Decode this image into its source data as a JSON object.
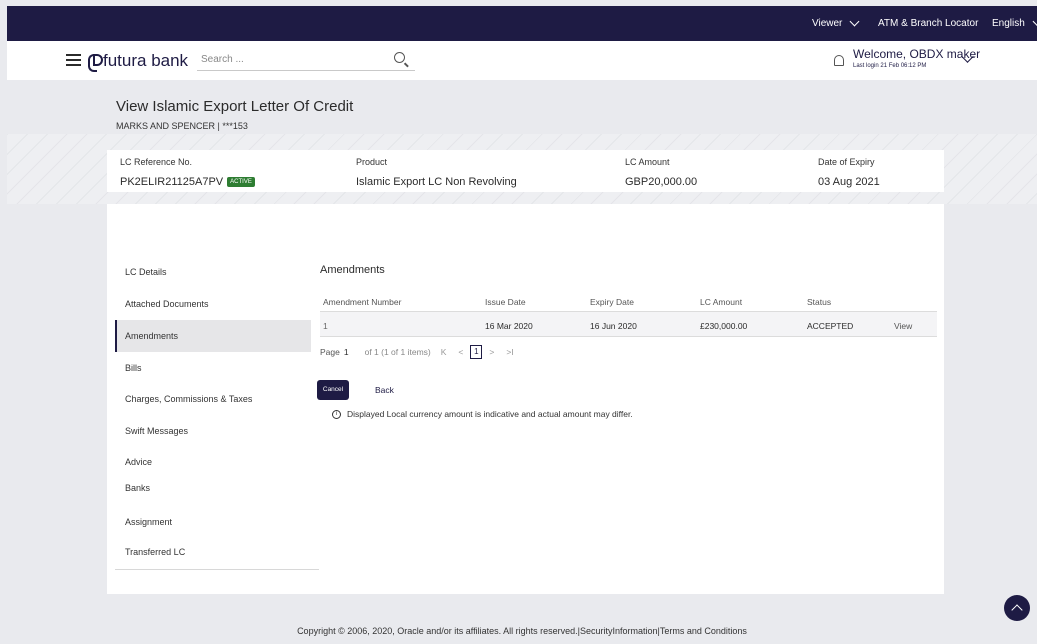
{
  "topbar": {
    "viewer_label": "Viewer",
    "atm_label": "ATM & Branch Locator",
    "language_label": "English"
  },
  "header": {
    "brand": "futura bank",
    "search_placeholder": "Search ...",
    "welcome": "Welcome, OBDX maker",
    "last_login": "Last login 21 Feb 06:12 PM"
  },
  "page": {
    "title": "View Islamic Export Letter Of Credit",
    "subtitle": "MARKS AND SPENCER | ***153"
  },
  "summary": {
    "lc_ref_label": "LC Reference No.",
    "lc_ref_value": "PK2ELIR21125A7PV",
    "status_badge": "ACTIVE",
    "product_label": "Product",
    "product_value": "Islamic Export LC Non Revolving",
    "amount_label": "LC Amount",
    "amount_value": "GBP20,000.00",
    "expiry_label": "Date of Expiry",
    "expiry_value": "03 Aug 2021"
  },
  "sidebar": {
    "items": [
      {
        "label": "LC Details"
      },
      {
        "label": "Attached Documents"
      },
      {
        "label": "Amendments"
      },
      {
        "label": "Bills"
      },
      {
        "label": "Charges, Commissions & Taxes"
      },
      {
        "label": "Swift Messages"
      },
      {
        "label": "Advice"
      },
      {
        "label": "Banks"
      },
      {
        "label": "Assignment"
      },
      {
        "label": "Transferred LC"
      }
    ]
  },
  "amendments": {
    "title": "Amendments",
    "columns": [
      "Amendment Number",
      "Issue Date",
      "Expiry Date",
      "LC Amount",
      "Status"
    ],
    "row": {
      "number": "1",
      "issue_date": "16 Mar 2020",
      "expiry_date": "16 Jun 2020",
      "amount": "£230,000.00",
      "status": "ACCEPTED",
      "action": "View"
    },
    "pager": {
      "page_label": "Page",
      "page_value": "1",
      "of_text": "of 1  (1 of 1 items)",
      "current": "1",
      "first": "K",
      "prev": "<",
      "next": ">",
      "last": ">I"
    }
  },
  "actions": {
    "cancel": "Cancel",
    "back": "Back"
  },
  "note": "Displayed Local currency amount is indicative and actual amount may differ.",
  "footer": "Copyright © 2006, 2020, Oracle and/or its affiliates. All rights reserved.|SecurityInformation|Terms and Conditions"
}
